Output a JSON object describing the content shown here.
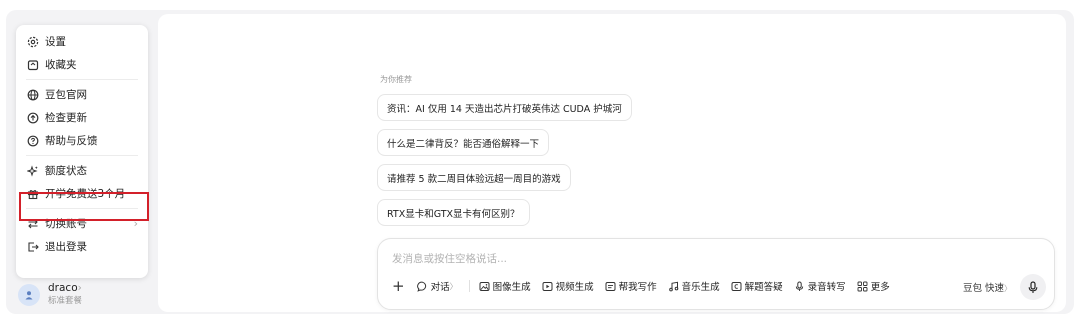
{
  "menu": {
    "items": [
      {
        "label": "设置",
        "icon": "gear-icon"
      },
      {
        "label": "收藏夹",
        "icon": "bookmark-box-icon"
      },
      {
        "label": "豆包官网",
        "icon": "globe-icon"
      },
      {
        "label": "检查更新",
        "icon": "upload-circle-icon"
      },
      {
        "label": "帮助与反馈",
        "icon": "help-circle-icon"
      },
      {
        "label": "额度状态",
        "icon": "sparkle-icon"
      },
      {
        "label": "开学免费送3个月",
        "icon": "gift-icon"
      },
      {
        "label": "切换账号",
        "icon": "switch-arrows-icon"
      },
      {
        "label": "退出登录",
        "icon": "logout-icon"
      }
    ],
    "chevron": "›"
  },
  "user": {
    "name": "draco",
    "name_chevron": "›",
    "plan": "标准套餐"
  },
  "recommend": {
    "label": "为你推荐",
    "items": [
      "资讯：AI 仅用 14 天造出芯片打破英伟达 CUDA 护城河",
      "什么是二律背反？能否通俗解释一下",
      "请推荐 5 款二周目体验远超一周目的游戏",
      "RTX显卡和GTX显卡有何区别？"
    ]
  },
  "input": {
    "placeholder": "发消息或按住空格说话...",
    "tools": [
      {
        "label": "对话",
        "icon": "chat-bubble-icon",
        "suffix": "〉"
      },
      {
        "label": "图像生成",
        "icon": "image-icon"
      },
      {
        "label": "视频生成",
        "icon": "video-icon"
      },
      {
        "label": "帮我写作",
        "icon": "write-icon"
      },
      {
        "label": "音乐生成",
        "icon": "music-icon"
      },
      {
        "label": "解题答疑",
        "icon": "calc-icon"
      },
      {
        "label": "录音转写",
        "icon": "record-icon"
      },
      {
        "label": "更多",
        "icon": "grid-icon"
      }
    ],
    "model": "豆包 快速",
    "model_chevron": "〉"
  },
  "colors": {
    "highlight": "#d3202a",
    "background": "#f3f3f5"
  }
}
